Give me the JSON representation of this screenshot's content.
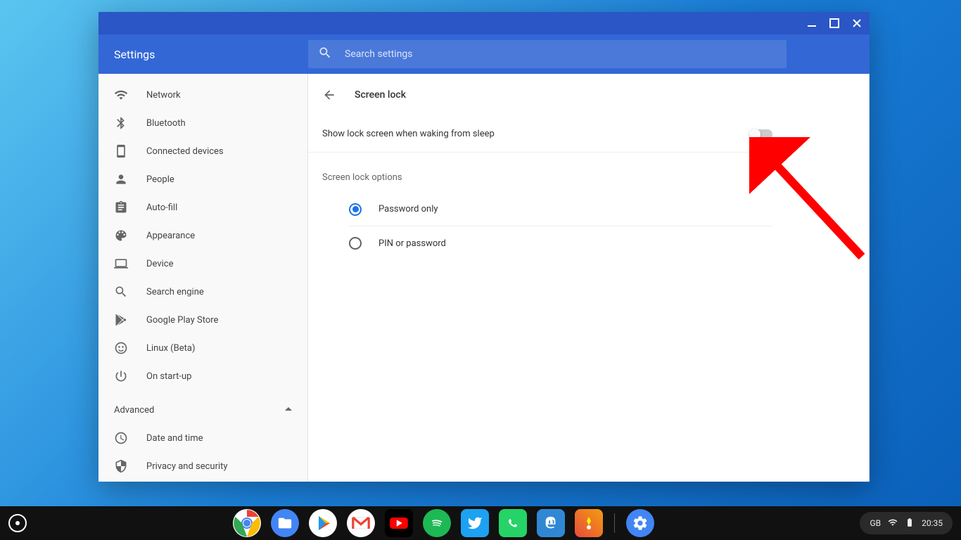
{
  "header": {
    "title": "Settings",
    "search_placeholder": "Search settings"
  },
  "sidebar": {
    "items": [
      {
        "label": "Network"
      },
      {
        "label": "Bluetooth"
      },
      {
        "label": "Connected devices"
      },
      {
        "label": "People"
      },
      {
        "label": "Auto-fill"
      },
      {
        "label": "Appearance"
      },
      {
        "label": "Device"
      },
      {
        "label": "Search engine"
      },
      {
        "label": "Google Play Store"
      },
      {
        "label": "Linux (Beta)"
      },
      {
        "label": "On start-up"
      }
    ],
    "advanced_label": "Advanced",
    "advanced_items": [
      {
        "label": "Date and time"
      },
      {
        "label": "Privacy and security"
      }
    ]
  },
  "page": {
    "title": "Screen lock",
    "toggle_label": "Show lock screen when waking from sleep",
    "toggle_on": false,
    "section_label": "Screen lock options",
    "options": [
      {
        "label": "Password only",
        "checked": true
      },
      {
        "label": "PIN or password",
        "checked": false
      }
    ]
  },
  "shelf": {
    "apps": [
      {
        "name": "chrome"
      },
      {
        "name": "files"
      },
      {
        "name": "play"
      },
      {
        "name": "gmail"
      },
      {
        "name": "youtube"
      },
      {
        "name": "spotify"
      },
      {
        "name": "twitter"
      },
      {
        "name": "whatsapp"
      },
      {
        "name": "mastodon"
      },
      {
        "name": "game"
      }
    ],
    "status": {
      "lang": "GB",
      "time": "20:35"
    }
  }
}
